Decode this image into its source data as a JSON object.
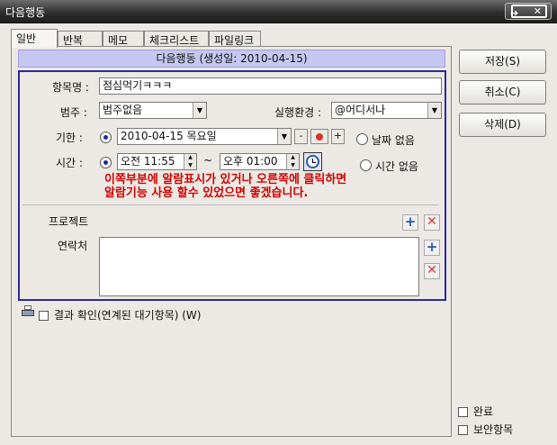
{
  "window": {
    "title": "다음행동"
  },
  "tabs": [
    {
      "label": "일반"
    },
    {
      "label": "반복"
    },
    {
      "label": "메모"
    },
    {
      "label": "체크리스트"
    },
    {
      "label": "파일링크"
    }
  ],
  "subtitle": "다음행동 (생성일: 2010-04-15)",
  "form": {
    "item_name_label": "항목명 :",
    "item_name_value": "점심먹기ㅋㅋㅋ",
    "category_label": "범주 :",
    "category_value": "범주없음",
    "context_label": "실행환경 :",
    "context_value": "@어디서나",
    "deadline_label": "기한 :",
    "deadline_value": "2010-04-15 목요일",
    "no_date_label": "날짜 없음",
    "time_label": "시간 :",
    "time_start": "오전 11:55",
    "time_sep": "~",
    "time_end": "오후 01:00",
    "no_time_label": "시간 없음",
    "annotation_line1": "이쪽부분에 알람표시가 있거나 오른쪽에 클릭하면",
    "annotation_line2": "알람기능 사용 할수 있었으면 좋겠습니다.",
    "project_label": "프로젝트",
    "contact_label": "연락처",
    "minus_label": "-",
    "plus_label": "+"
  },
  "footer": {
    "result_check_label": "결과 확인(연계된 대기항목) (W)",
    "complete_label": "완료",
    "secure_label": "보안항목"
  },
  "buttons": {
    "save": "저장(S)",
    "cancel": "취소(C)",
    "delete": "삭제(D)"
  },
  "colors": {
    "form_border": "#2a2a9e",
    "subtitle_bg": "#c5c7f0",
    "annotation": "#d10000"
  }
}
